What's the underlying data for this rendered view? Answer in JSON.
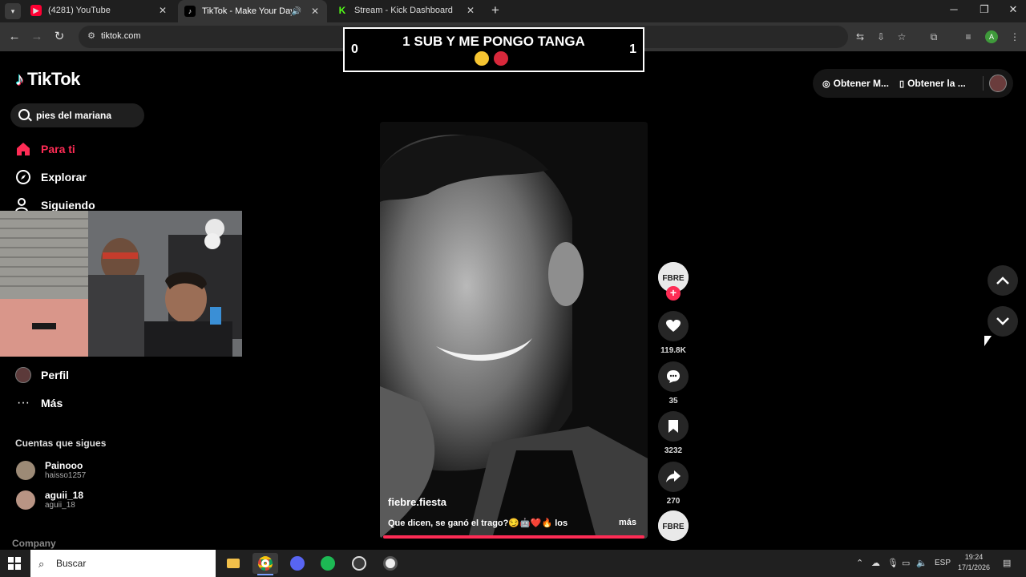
{
  "browser": {
    "tabs": [
      {
        "title": "(4281) YouTube",
        "favicon": "youtube-icon",
        "color": "#ff0033"
      },
      {
        "title": "TikTok - Make Your Day",
        "favicon": "tiktok-icon",
        "color": "#000000"
      },
      {
        "title": "Stream - Kick Dashboard",
        "favicon": "kick-icon",
        "color": "#53fc18"
      }
    ],
    "url": "tiktok.com",
    "profile_initial": "A"
  },
  "overlay": {
    "title": "1 SUB Y ME PONGO TANGA",
    "left_count": "0",
    "right_count": "1"
  },
  "sidebar": {
    "brand": "TikTok",
    "search_value": "pies del mariana",
    "nav": [
      {
        "label": "Para ti",
        "icon": "home-icon"
      },
      {
        "label": "Explorar",
        "icon": "compass-icon"
      },
      {
        "label": "Siguiendo",
        "icon": "following-icon"
      },
      {
        "label": "Perfil",
        "icon": "profile-icon"
      },
      {
        "label": "Más",
        "icon": "more-icon"
      }
    ],
    "following_title": "Cuentas que sigues",
    "following": [
      {
        "name": "Painooo",
        "handle": "haisso1257"
      },
      {
        "name": "aguii_18",
        "handle": "aguii_18"
      }
    ],
    "company": "Company"
  },
  "header_right": {
    "btn1": "Obtener M...",
    "btn2": "Obtener la ..."
  },
  "video": {
    "author": "fiebre.fiesta",
    "caption": "Que dicen, se ganó el trago?😏🤖❤️🔥 los",
    "more": "más",
    "likes": "119.8K",
    "comments": "35",
    "saves": "3232",
    "shares": "270",
    "progress": 1.0,
    "accent": "#fe2c55"
  },
  "taskbar": {
    "search_placeholder": "Buscar",
    "lang": "ESP",
    "time": "19:24",
    "date": "17/1/2026"
  }
}
